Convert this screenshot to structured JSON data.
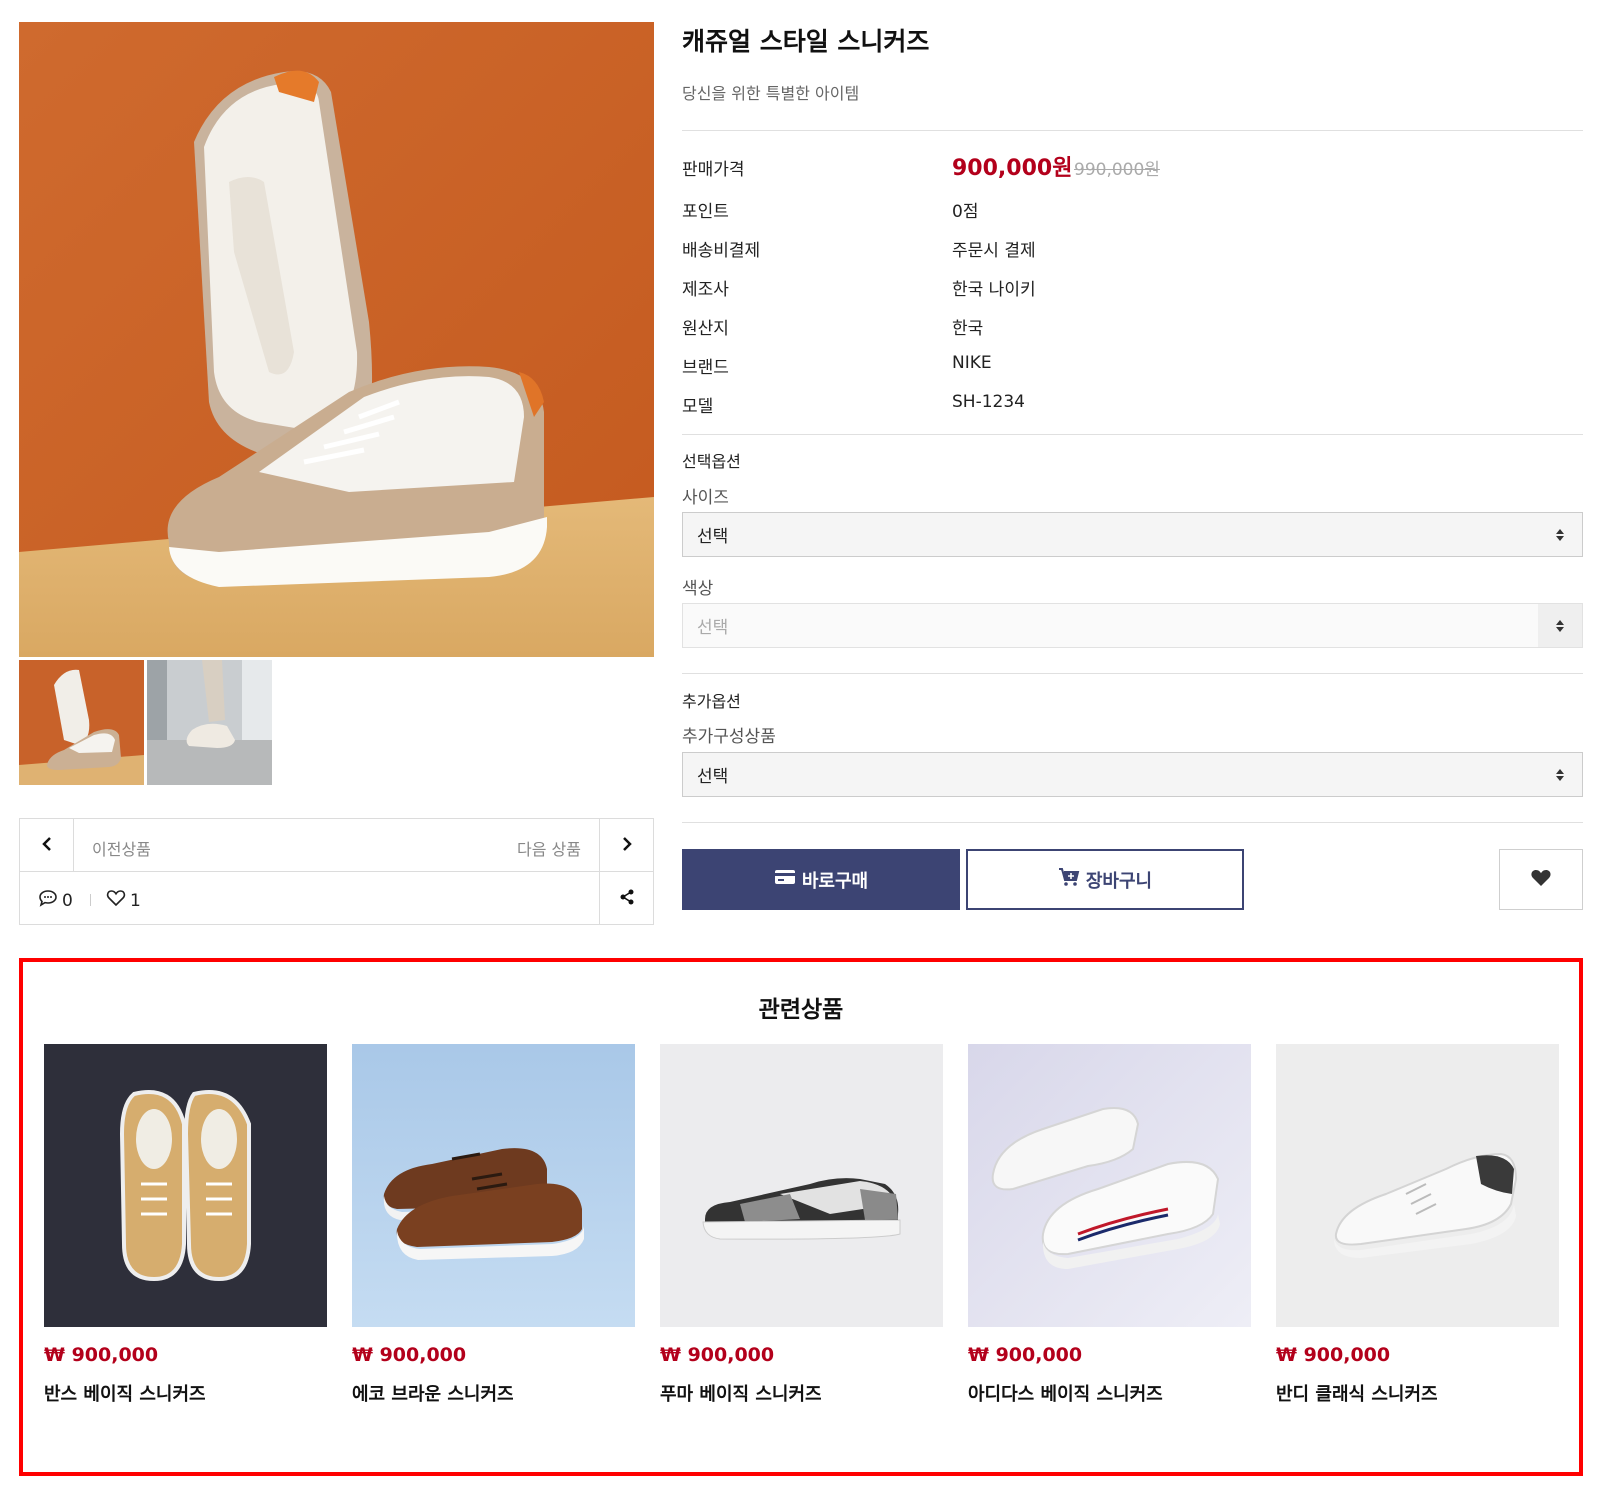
{
  "product": {
    "title": "캐쥬얼 스타일 스니커즈",
    "subtitle": "당신을 위한 특별한 아이템",
    "price_label": "판매가격",
    "price": "900,000원",
    "price_original": "990,000원",
    "info": [
      {
        "label": "포인트",
        "value": "0점"
      },
      {
        "label": "배송비결제",
        "value": "주문시 결제"
      },
      {
        "label": "제조사",
        "value": "한국 나이키"
      },
      {
        "label": "원산지",
        "value": "한국"
      },
      {
        "label": "브랜드",
        "value": "NIKE"
      },
      {
        "label": "모델",
        "value": "SH-1234"
      }
    ]
  },
  "options": {
    "heading": "선택옵션",
    "size_label": "사이즈",
    "size_value": "선택",
    "color_label": "색상",
    "color_value": "선택"
  },
  "extra": {
    "heading": "추가옵션",
    "label": "추가구성상품",
    "value": "선택"
  },
  "actions": {
    "buy": "바로구매",
    "cart": "장바구니"
  },
  "navigation": {
    "prev": "이전상품",
    "next": "다음 상품",
    "comments": "0",
    "likes": "1"
  },
  "related": {
    "title": "관련상품",
    "items": [
      {
        "price": "₩ 900,000",
        "name": "반스 베이직 스니커즈"
      },
      {
        "price": "₩ 900,000",
        "name": "에코 브라운 스니커즈"
      },
      {
        "price": "₩ 900,000",
        "name": "푸마 베이직 스니커즈"
      },
      {
        "price": "₩ 900,000",
        "name": "아디다스 베이직 스니커즈"
      },
      {
        "price": "₩ 900,000",
        "name": "반디 클래식 스니커즈"
      }
    ]
  },
  "colors": {
    "accent": "#3c4473",
    "price": "#b3001b",
    "highlight_border": "#ff0000"
  }
}
